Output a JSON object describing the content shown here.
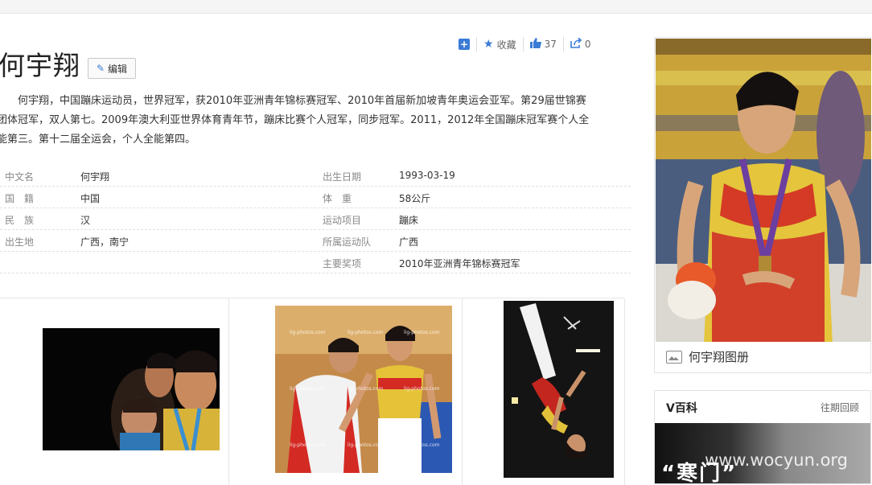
{
  "header": {
    "title": "何宇翔",
    "edit_label": "编辑",
    "favorite_label": "收藏",
    "like_count": "37",
    "share_count": "0"
  },
  "summary": {
    "line1": "何宇翔，中国蹦床运动员，世界冠军，获2010年亚洲青年锦标赛冠军、2010年首届新加坡青年奥运会亚军。第29届世锦赛",
    "line2": "团体冠军，双人第七。2009年澳大利亚世界体育青年节，蹦床比赛个人冠军，同步冠军。2011，2012年全国蹦床冠军赛个人全",
    "line3": "能第三。第十二届全运会，个人全能第四。"
  },
  "info": {
    "rows": [
      {
        "k1": "中文名",
        "v1": "何宇翔",
        "k2": "出生日期",
        "v2": "1993-03-19"
      },
      {
        "k1": "国　籍",
        "v1": "中国",
        "k2": "体　重",
        "v2": "58公斤"
      },
      {
        "k1": "民　族",
        "v1": "汉",
        "k2": "运动项目",
        "v2": "蹦床"
      },
      {
        "k1": "出生地",
        "v1": "广西，南宁",
        "k2": "所属运动队",
        "v2": "广西"
      },
      {
        "k1": "",
        "v1": "",
        "k2": "主要奖项",
        "v2": "2010年亚洲青年锦标赛冠军"
      }
    ]
  },
  "gallery": {
    "watermark": "lig-photos.com"
  },
  "sidebar": {
    "album_label": "何宇翔图册"
  },
  "vbaike": {
    "title": "V百科",
    "more": "往期回顾",
    "banner_text": "“寒门”"
  },
  "site_watermark": "www.wocyun.org",
  "colors": {
    "accent": "#3a7bd5",
    "border": "#e6e6e6"
  },
  "icons": [
    "plus-icon",
    "star-icon",
    "thumbs-up-icon",
    "share-icon",
    "pencil-icon",
    "image-icon"
  ]
}
